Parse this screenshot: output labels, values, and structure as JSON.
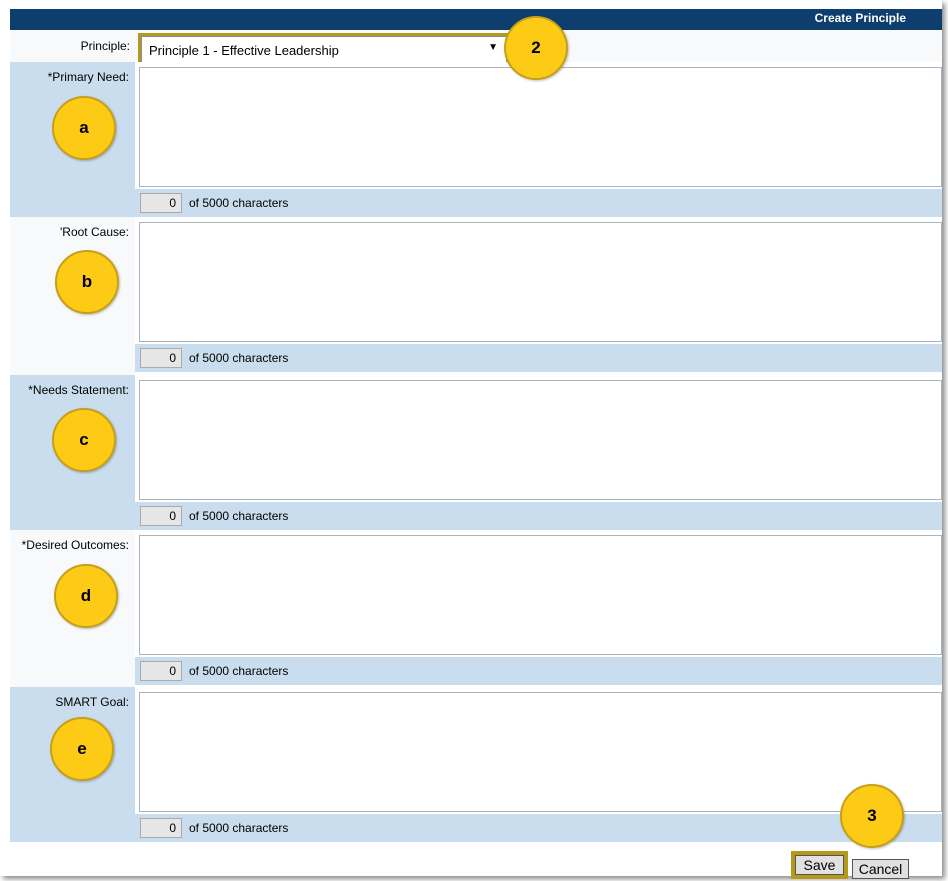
{
  "header": {
    "title": "Create Principle"
  },
  "principle": {
    "label": "Principle:",
    "selected": "Principle 1 - Effective Leadership",
    "arrow": "▼"
  },
  "sections": [
    {
      "label": "*Primary Need:",
      "count": "0",
      "counter_text": "of 5000 characters",
      "marker": "a"
    },
    {
      "label": "'Root Cause:",
      "count": "0",
      "counter_text": "of 5000 characters",
      "marker": "b"
    },
    {
      "label": "*Needs Statement:",
      "count": "0",
      "counter_text": "of 5000 characters",
      "marker": "c"
    },
    {
      "label": "*Desired Outcomes:",
      "count": "0",
      "counter_text": "of 5000 characters",
      "marker": "d"
    },
    {
      "label": "SMART Goal:",
      "count": "0",
      "counter_text": "of 5000 characters",
      "marker": "e"
    }
  ],
  "markers": {
    "select": "2",
    "save": "3"
  },
  "actions": {
    "save_label": "Save",
    "cancel_label": "Cancel"
  },
  "colors": {
    "header": "#0e3e6d",
    "section_blue": "#c9ddee",
    "marker": "#fdcb16",
    "highlight": "#b39a1a"
  }
}
